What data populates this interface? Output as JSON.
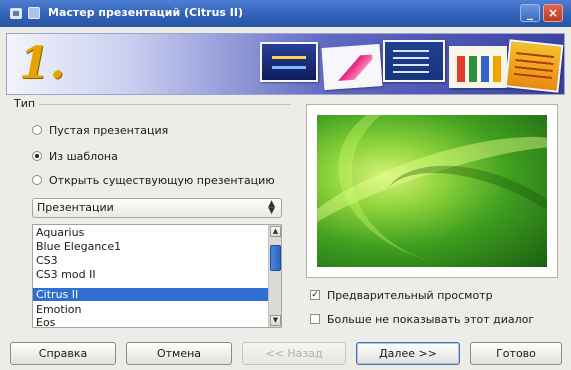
{
  "window": {
    "title": "Мастер презентаций (Citrus II)",
    "minimize_glyph": "_",
    "close_glyph": "×"
  },
  "banner": {
    "step": "1."
  },
  "type_group": {
    "label": "Тип",
    "options": [
      {
        "label": "Пустая презентация",
        "selected": false
      },
      {
        "label": "Из шаблона",
        "selected": true
      },
      {
        "label": "Открыть существующую презентацию",
        "selected": false
      }
    ]
  },
  "category_select": {
    "value": "Презентации"
  },
  "template_list": {
    "items": [
      "Aquarius",
      "Blue Elegance1",
      "CS3",
      "CS3 mod II",
      "Citrus II",
      "Emotion",
      "Eos"
    ],
    "selected_index": 4
  },
  "options": {
    "preview_label": "Предварительный просмотр",
    "preview_checked": true,
    "dont_show_label": "Больше не показывать этот диалог",
    "dont_show_checked": false
  },
  "buttons": {
    "help": "Справка",
    "cancel": "Отмена",
    "back": "<< Назад",
    "next": "Далее >>",
    "finish": "Готово"
  }
}
